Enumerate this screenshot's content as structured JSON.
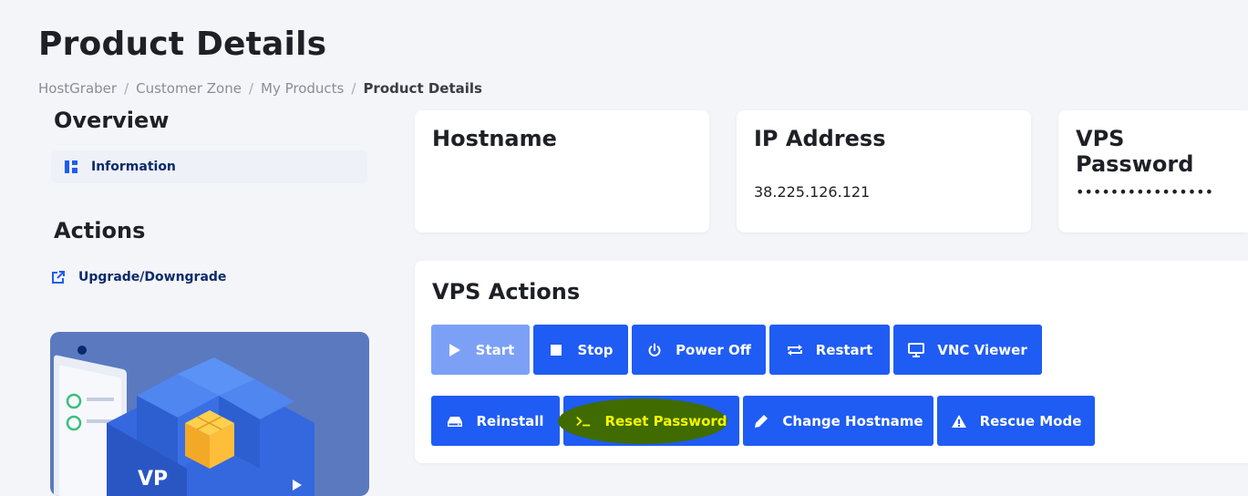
{
  "page": {
    "title": "Product Details",
    "breadcrumb": [
      "HostGraber",
      "Customer Zone",
      "My Products",
      "Product Details"
    ]
  },
  "sidebar": {
    "overview_heading": "Overview",
    "information_label": "Information",
    "actions_heading": "Actions",
    "upgrade_label": "Upgrade/Downgrade",
    "promo_text": "VP"
  },
  "info_cards": {
    "hostname": {
      "title": "Hostname",
      "value": ""
    },
    "ip": {
      "title": "IP Address",
      "value": "38.225.126.121"
    },
    "password": {
      "title": "VPS Password",
      "value": "••••••••••••••••"
    }
  },
  "vps_actions": {
    "title": "VPS Actions",
    "start": "Start",
    "stop": "Stop",
    "power_off": "Power Off",
    "restart": "Restart",
    "vnc": "VNC Viewer",
    "reinstall": "Reinstall",
    "reset_password": "Reset Password",
    "change_hostname": "Change Hostname",
    "rescue_mode": "Rescue Mode"
  },
  "colors": {
    "primary": "#1f5cf3",
    "primary_disabled": "#7da0f7",
    "highlight_bg": "#3f6b00",
    "highlight_text": "#f7f700",
    "nav_text": "#0b2a6b"
  }
}
